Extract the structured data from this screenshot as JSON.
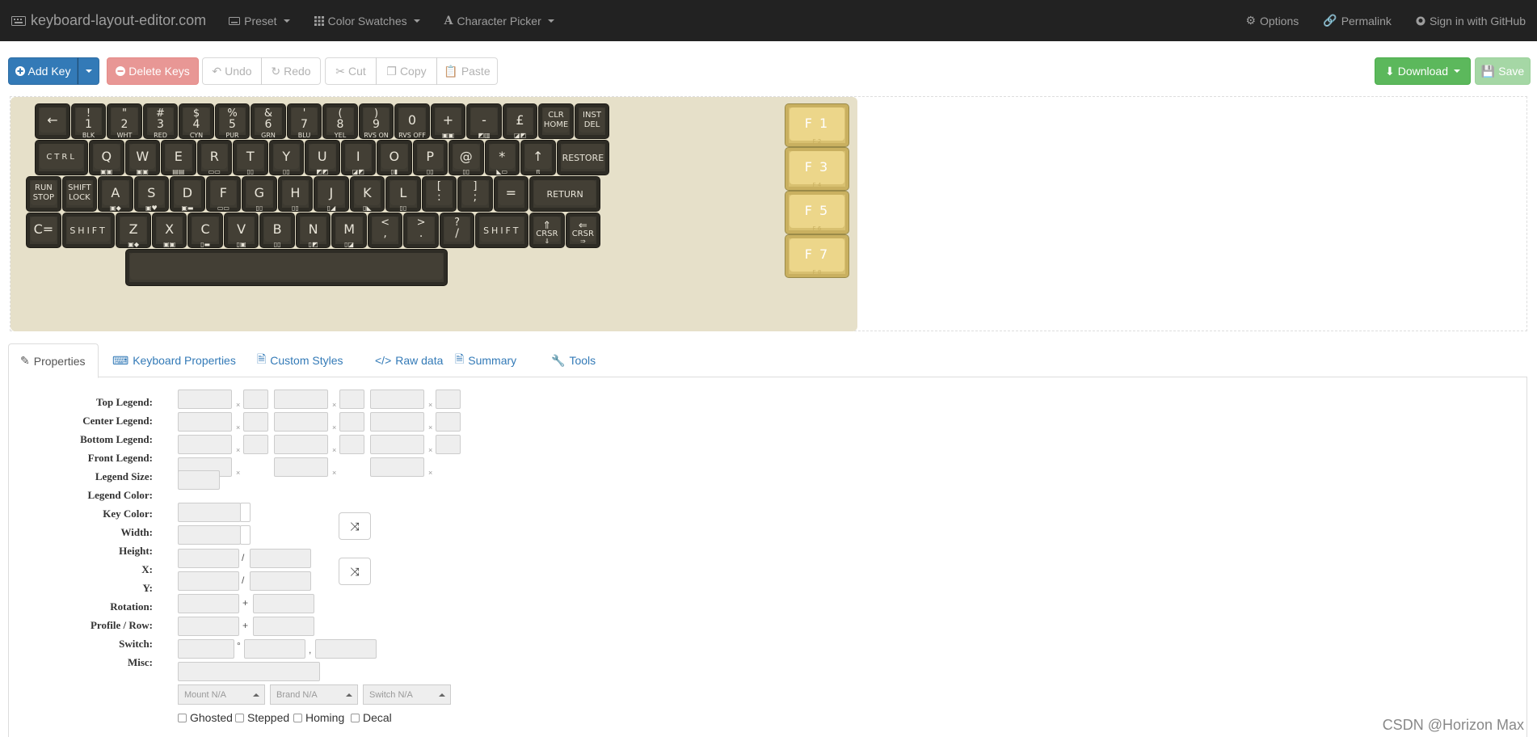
{
  "nav": {
    "brand": "keyboard-layout-editor.com",
    "menus": [
      "Preset",
      "Color Swatches",
      "Character Picker"
    ],
    "right": [
      "Options",
      "Permalink",
      "Sign in with GitHub"
    ]
  },
  "toolbar": {
    "add_key": "Add Key",
    "delete_keys": "Delete Keys",
    "undo": "Undo",
    "redo": "Redo",
    "cut": "Cut",
    "copy": "Copy",
    "paste": "Paste",
    "download": "Download",
    "save": "Save"
  },
  "keyboard": {
    "colors": {
      "key": "#3d3a31",
      "legend": "#e8e4d8",
      "fkey": "#ecd68a",
      "background": "#e6e0c9"
    },
    "rows": [
      [
        {
          "top": "",
          "main": "←",
          "sub": ""
        },
        {
          "top": "!",
          "main": "1",
          "sub": "BLK"
        },
        {
          "top": "\"",
          "main": "2",
          "sub": "WHT"
        },
        {
          "top": "#",
          "main": "3",
          "sub": "RED"
        },
        {
          "top": "$",
          "main": "4",
          "sub": "CYN"
        },
        {
          "top": "%",
          "main": "5",
          "sub": "PUR"
        },
        {
          "top": "&",
          "main": "6",
          "sub": "GRN"
        },
        {
          "top": "'",
          "main": "7",
          "sub": "BLU"
        },
        {
          "top": "(",
          "main": "8",
          "sub": "YEL"
        },
        {
          "top": ")",
          "main": "9",
          "sub": "RVS ON"
        },
        {
          "top": "",
          "main": "0",
          "sub": "RVS OFF"
        },
        {
          "top": "",
          "main": "+",
          "sub": "▣▣"
        },
        {
          "top": "",
          "main": "-",
          "sub": "◩▥"
        },
        {
          "top": "",
          "main": "£",
          "sub": "◪◩"
        },
        {
          "top": "CLR",
          "main": "HOME",
          "sub": ""
        },
        {
          "top": "INST",
          "main": "DEL",
          "sub": ""
        }
      ],
      [
        {
          "top": "",
          "main": "CTRL",
          "sub": ""
        },
        {
          "top": "",
          "main": "Q",
          "sub": "▣▣"
        },
        {
          "top": "",
          "main": "W",
          "sub": "▣▣"
        },
        {
          "top": "",
          "main": "E",
          "sub": "▤▤"
        },
        {
          "top": "",
          "main": "R",
          "sub": "▭▭"
        },
        {
          "top": "",
          "main": "T",
          "sub": "▯▯"
        },
        {
          "top": "",
          "main": "Y",
          "sub": "▯▯"
        },
        {
          "top": "",
          "main": "U",
          "sub": "◩◩"
        },
        {
          "top": "",
          "main": "I",
          "sub": "◪◩"
        },
        {
          "top": "",
          "main": "O",
          "sub": "▯▮"
        },
        {
          "top": "",
          "main": "P",
          "sub": "▯▯"
        },
        {
          "top": "",
          "main": "@",
          "sub": "▯▯"
        },
        {
          "top": "",
          "main": "*",
          "sub": "◣▭"
        },
        {
          "top": "",
          "main": "↑",
          "sub": "π"
        },
        {
          "top": "",
          "main": "RESTORE",
          "sub": ""
        }
      ],
      [
        {
          "top": "RUN",
          "main": "STOP",
          "sub": ""
        },
        {
          "top": "SHIFT",
          "main": "LOCK",
          "sub": ""
        },
        {
          "top": "",
          "main": "A",
          "sub": "▣◆"
        },
        {
          "top": "",
          "main": "S",
          "sub": "▣♥"
        },
        {
          "top": "",
          "main": "D",
          "sub": "▣▬"
        },
        {
          "top": "",
          "main": "F",
          "sub": "▭▭"
        },
        {
          "top": "",
          "main": "G",
          "sub": "▯▯"
        },
        {
          "top": "",
          "main": "H",
          "sub": "▯▯"
        },
        {
          "top": "",
          "main": "J",
          "sub": "▯◢"
        },
        {
          "top": "",
          "main": "K",
          "sub": "▯◣"
        },
        {
          "top": "",
          "main": "L",
          "sub": "▯▯"
        },
        {
          "top": "[",
          "main": ":",
          "sub": ""
        },
        {
          "top": "]",
          "main": ";",
          "sub": ""
        },
        {
          "top": "",
          "main": "=",
          "sub": ""
        },
        {
          "top": "",
          "main": "RETURN",
          "sub": ""
        }
      ],
      [
        {
          "top": "",
          "main": "C=",
          "sub": ""
        },
        {
          "top": "",
          "main": "SHIFT",
          "sub": ""
        },
        {
          "top": "",
          "main": "Z",
          "sub": "▣◆"
        },
        {
          "top": "",
          "main": "X",
          "sub": "▣▣"
        },
        {
          "top": "",
          "main": "C",
          "sub": "▯▬"
        },
        {
          "top": "",
          "main": "V",
          "sub": "▯▣"
        },
        {
          "top": "",
          "main": "B",
          "sub": "▯▯"
        },
        {
          "top": "",
          "main": "N",
          "sub": "▯◩"
        },
        {
          "top": "",
          "main": "M",
          "sub": "▯◪"
        },
        {
          "top": "<",
          "main": ",",
          "sub": ""
        },
        {
          "top": ">",
          "main": ".",
          "sub": ""
        },
        {
          "top": "?",
          "main": "/",
          "sub": ""
        },
        {
          "top": "",
          "main": "SHIFT",
          "sub": ""
        },
        {
          "top": "⇑",
          "main": "CRSR",
          "sub": "⇓"
        },
        {
          "top": "⇐",
          "main": "CRSR",
          "sub": "⇒"
        }
      ],
      [
        {
          "top": "",
          "main": "",
          "sub": ""
        }
      ]
    ],
    "fkeys": [
      {
        "main": "F 1",
        "sub": "F 2"
      },
      {
        "main": "F 3",
        "sub": "F 4"
      },
      {
        "main": "F 5",
        "sub": "F 6"
      },
      {
        "main": "F 7",
        "sub": "F 8"
      }
    ]
  },
  "tabs": [
    "Properties",
    "Keyboard Properties",
    "Custom Styles",
    "Raw data",
    "Summary",
    "Tools"
  ],
  "properties": {
    "labels": [
      "Top Legend:",
      "Center Legend:",
      "Bottom Legend:",
      "Front Legend:",
      "Legend Size:",
      "Legend Color:",
      "Key Color:",
      "Width:",
      "Height:",
      "X:",
      "Y:",
      "Rotation:",
      "Profile / Row:",
      "Switch:",
      "Misc:"
    ],
    "switch_options": [
      "Mount N/A",
      "Brand N/A",
      "Switch N/A"
    ],
    "misc_options": [
      "Ghosted",
      "Stepped",
      "Homing",
      "Decal"
    ],
    "size_sep": "/",
    "pos_sep": "+",
    "rot_deg": "°",
    "rot_comma": ","
  },
  "watermark": "CSDN @Horizon Max"
}
